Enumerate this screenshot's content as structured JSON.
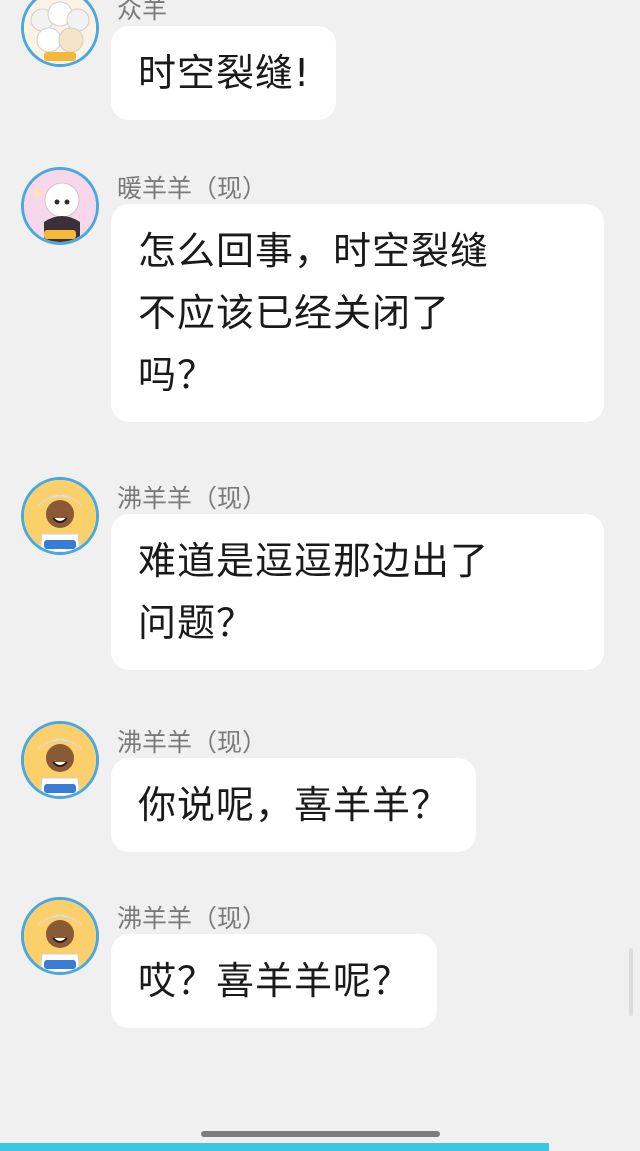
{
  "messages": [
    {
      "sender": "众羊",
      "text": "时空裂缝!",
      "avatar_icon": "group-goats-avatar-icon"
    },
    {
      "sender": "暖羊羊（现）",
      "text": "怎么回事，时空裂缝\n不应该已经关闭了\n吗？",
      "avatar_icon": "nuan-yang-yang-avatar-icon"
    },
    {
      "sender": "沸羊羊（现）",
      "text": "难道是逗逗那边出了\n问题？",
      "avatar_icon": "fei-yang-yang-avatar-icon"
    },
    {
      "sender": "沸羊羊（现）",
      "text": "你说呢，喜羊羊？",
      "avatar_icon": "fei-yang-yang-avatar-icon"
    },
    {
      "sender": "沸羊羊（现）",
      "text": "哎？喜羊羊呢？",
      "avatar_icon": "fei-yang-yang-avatar-icon"
    }
  ],
  "colors": {
    "background": "#f0f0f0",
    "bubble": "#ffffff",
    "sender_text": "#7a7a7a",
    "message_text": "#1a1a1a",
    "avatar_ring": "#4aa8dc",
    "accent_strip": "#3cc6e6"
  }
}
